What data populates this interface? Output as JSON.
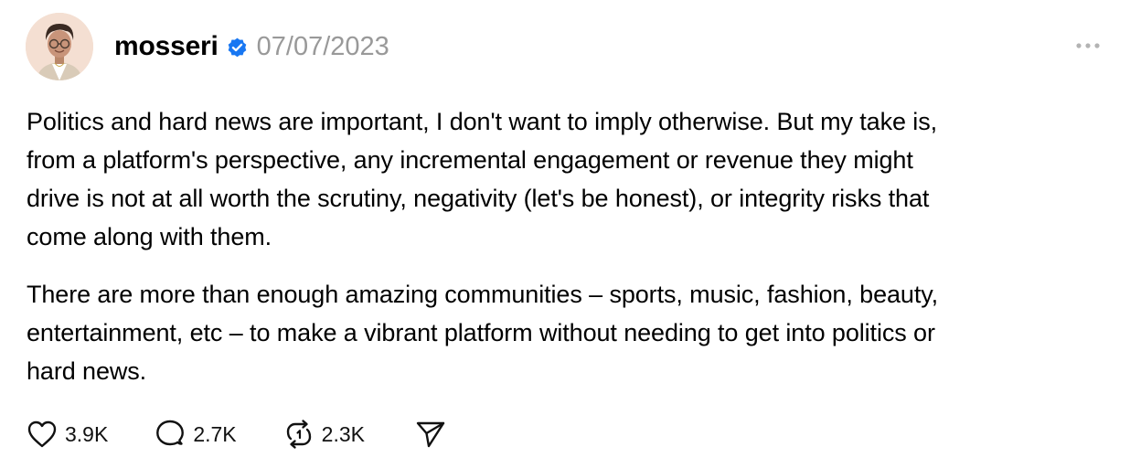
{
  "post": {
    "username": "mosseri",
    "verified": true,
    "date": "07/07/2023",
    "more_icon": "more-horizontal-icon",
    "paragraphs": [
      "Politics and hard news are important, I don't want to imply otherwise. But my take is,\nfrom a platform's perspective, any incremental engagement or revenue they might\ndrive is not at all worth the scrutiny, negativity (let's be honest), or integrity risks that\ncome along with them.",
      "There are more than enough amazing communities – sports, music, fashion, beauty,\nentertainment, etc – to make a vibrant platform without needing to get into politics or\nhard news."
    ],
    "actions": {
      "like": {
        "icon": "heart-icon",
        "count": "3.9K"
      },
      "reply": {
        "icon": "speech-bubble-icon",
        "count": "2.7K"
      },
      "repost": {
        "icon": "repost-icon",
        "count": "2.3K"
      },
      "share": {
        "icon": "paper-plane-icon"
      }
    }
  },
  "colors": {
    "text": "#000000",
    "muted": "#999999",
    "verified_badge": "#1877f2"
  }
}
